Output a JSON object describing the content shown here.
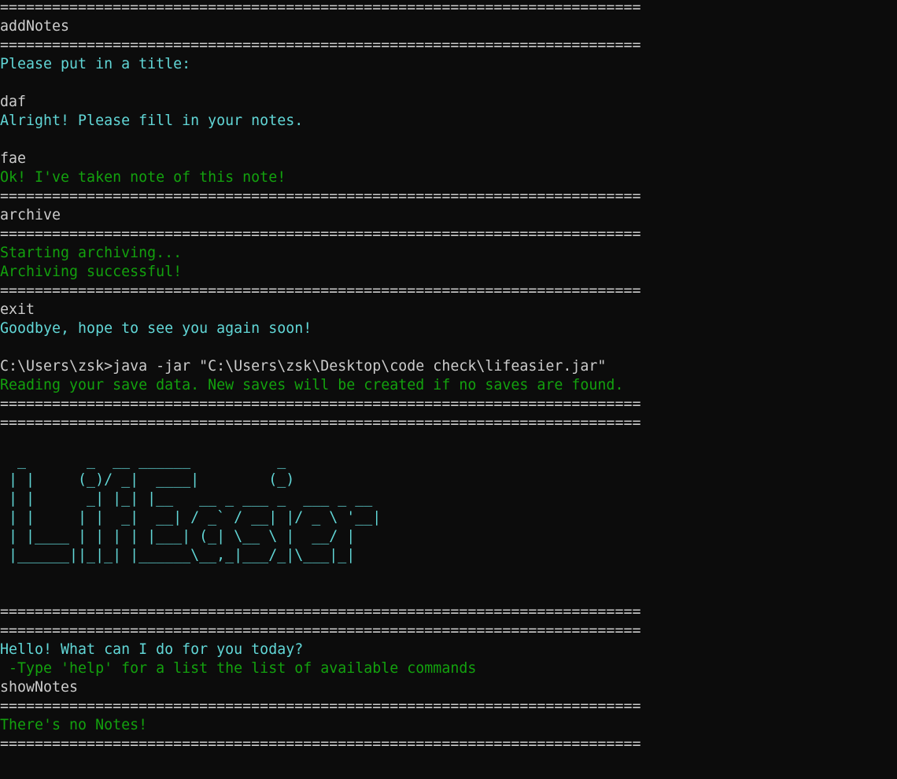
{
  "terminal": {
    "colors": {
      "background": "#0c0c0c",
      "white": "#cccccc",
      "cyan": "#61d6d6",
      "green": "#13a10e"
    },
    "lines": [
      {
        "kind": "separator",
        "color": "white",
        "text": "=========================================================================="
      },
      {
        "kind": "user-input",
        "color": "white",
        "text": "addNotes"
      },
      {
        "kind": "separator",
        "color": "white",
        "text": "=========================================================================="
      },
      {
        "kind": "prompt",
        "color": "cyan",
        "text": "Please put in a title:"
      },
      {
        "kind": "blank",
        "color": "white",
        "text": ""
      },
      {
        "kind": "user-input",
        "color": "white",
        "text": "daf"
      },
      {
        "kind": "prompt",
        "color": "cyan",
        "text": "Alright! Please fill in your notes."
      },
      {
        "kind": "blank",
        "color": "white",
        "text": ""
      },
      {
        "kind": "user-input",
        "color": "white",
        "text": "fae"
      },
      {
        "kind": "success-message",
        "color": "green",
        "text": "Ok! I've taken note of this note!"
      },
      {
        "kind": "separator",
        "color": "white",
        "text": "=========================================================================="
      },
      {
        "kind": "user-input",
        "color": "white",
        "text": "archive"
      },
      {
        "kind": "separator",
        "color": "white",
        "text": "=========================================================================="
      },
      {
        "kind": "success-message",
        "color": "green",
        "text": "Starting archiving..."
      },
      {
        "kind": "success-message",
        "color": "green",
        "text": "Archiving successful!"
      },
      {
        "kind": "separator",
        "color": "white",
        "text": "=========================================================================="
      },
      {
        "kind": "user-input",
        "color": "white",
        "text": "exit"
      },
      {
        "kind": "prompt",
        "color": "cyan",
        "text": "Goodbye, hope to see you again soon!"
      },
      {
        "kind": "blank",
        "color": "white",
        "text": ""
      },
      {
        "kind": "shell-command",
        "color": "white",
        "text": "C:\\Users\\zsk>java -jar \"C:\\Users\\zsk\\Desktop\\code check\\lifeasier.jar\""
      },
      {
        "kind": "success-message",
        "color": "green",
        "text": "Reading your save data. New saves will be created if no saves are found."
      },
      {
        "kind": "separator",
        "color": "white",
        "text": "=========================================================================="
      },
      {
        "kind": "separator",
        "color": "white",
        "text": "=========================================================================="
      },
      {
        "kind": "blank",
        "color": "white",
        "text": ""
      },
      {
        "kind": "ascii-logo",
        "color": "cyan",
        "text": "  _       _  __ ______          _"
      },
      {
        "kind": "ascii-logo",
        "color": "cyan",
        "text": " | |     (_)/ _|  ____|        (_)"
      },
      {
        "kind": "ascii-logo",
        "color": "cyan",
        "text": " | |      _| |_| |__   __ _ ___ _  ___ _ __"
      },
      {
        "kind": "ascii-logo",
        "color": "cyan",
        "text": " | |     | |  _|  __| / _` / __| |/ _ \\ '__|"
      },
      {
        "kind": "ascii-logo",
        "color": "cyan",
        "text": " | |____ | | | | |___| (_| \\__ \\ |  __/ |"
      },
      {
        "kind": "ascii-logo",
        "color": "cyan",
        "text": " |______||_|_| |______\\__,_|___/_|\\___|_|"
      },
      {
        "kind": "blank",
        "color": "white",
        "text": ""
      },
      {
        "kind": "blank",
        "color": "white",
        "text": ""
      },
      {
        "kind": "separator",
        "color": "white",
        "text": "=========================================================================="
      },
      {
        "kind": "separator",
        "color": "white",
        "text": "=========================================================================="
      },
      {
        "kind": "prompt",
        "color": "cyan",
        "text": "Hello! What can I do for you today?"
      },
      {
        "kind": "help-hint",
        "color": "green",
        "text": " -Type 'help' for a list the list of available commands"
      },
      {
        "kind": "user-input",
        "color": "white",
        "text": "showNotes"
      },
      {
        "kind": "separator",
        "color": "white",
        "text": "=========================================================================="
      },
      {
        "kind": "success-message",
        "color": "green",
        "text": "There's no Notes!"
      },
      {
        "kind": "separator",
        "color": "white",
        "text": "=========================================================================="
      }
    ]
  }
}
